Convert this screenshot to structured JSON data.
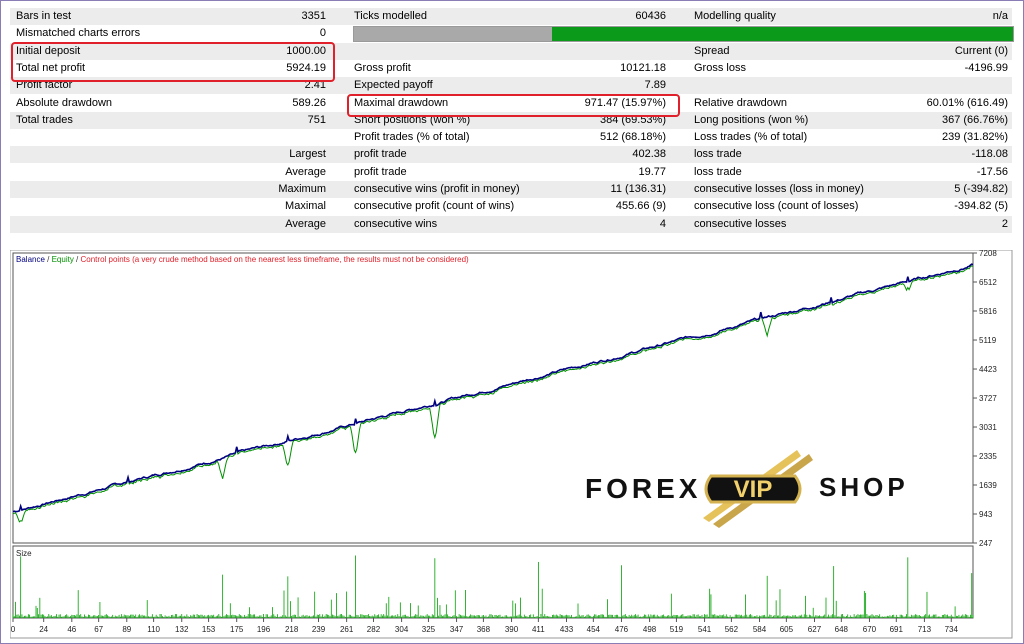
{
  "report": {
    "rows": [
      {
        "c1": "Bars in test",
        "c2": "3351",
        "c3": "Ticks modelled",
        "c4": "60436",
        "c5": "Modelling quality",
        "c6": "n/a"
      },
      {
        "c1": "Mismatched charts errors",
        "c2": "0",
        "c3": "",
        "c4": "",
        "c5": "",
        "c6": ""
      },
      {
        "c1": "Initial deposit",
        "c2": "1000.00",
        "c3": "",
        "c4": "",
        "c5": "Spread",
        "c6": "Current (0)"
      },
      {
        "c1": "Total net profit",
        "c2": "5924.19",
        "c3": "Gross profit",
        "c4": "10121.18",
        "c5": "Gross loss",
        "c6": "-4196.99"
      },
      {
        "c1": "Profit factor",
        "c2": "2.41",
        "c3": "Expected payoff",
        "c4": "7.89",
        "c5": "",
        "c6": ""
      },
      {
        "c1": "Absolute drawdown",
        "c2": "589.26",
        "c3": "Maximal drawdown",
        "c4": "971.47 (15.97%)",
        "c5": "Relative drawdown",
        "c6": "60.01% (616.49)"
      },
      {
        "c1": "Total trades",
        "c2": "751",
        "c3": "Short positions (won %)",
        "c4": "384 (69.53%)",
        "c5": "Long positions (won %)",
        "c6": "367 (66.76%)"
      },
      {
        "c1": "",
        "c2": "",
        "c3": "Profit trades (% of total)",
        "c4": "512 (68.18%)",
        "c5": "Loss trades (% of total)",
        "c6": "239 (31.82%)"
      },
      {
        "c1r": "Largest",
        "c3": "profit trade",
        "c4": "402.38",
        "c5": "loss trade",
        "c6": "-118.08"
      },
      {
        "c1r": "Average",
        "c3": "profit trade",
        "c4": "19.77",
        "c5": "loss trade",
        "c6": "-17.56"
      },
      {
        "c1r": "Maximum",
        "c3": "consecutive wins (profit in money)",
        "c4": "11 (136.31)",
        "c5": "consecutive losses (loss in money)",
        "c6": "5 (-394.82)"
      },
      {
        "c1r": "Maximal",
        "c3": "consecutive profit (count of wins)",
        "c4": "455.66 (9)",
        "c5": "consecutive loss (count of losses)",
        "c6": "-394.82 (5)"
      },
      {
        "c1r": "Average",
        "c3": "consecutive wins",
        "c4": "4",
        "c5": "consecutive losses",
        "c6": "2"
      }
    ],
    "modelling_quality_bar": {
      "gray_fraction": 0.3,
      "colors": {
        "gray": "#a9a9a9",
        "green": "#0c9a1a"
      }
    },
    "highlight_color": "#e0202a"
  },
  "chart_data": {
    "type": "line",
    "legend": {
      "balance": "Balance",
      "equity": "Equity",
      "control": "Control points (a very crude method based on the nearest less timeframe, the results must not be considered)"
    },
    "colors": {
      "balance": "#000080",
      "equity": "#009000",
      "control": "#e0202a",
      "size_bars": "#00a000",
      "legend_balance": "#000080",
      "legend_equity": "#009000"
    },
    "ylim": [
      247,
      7208
    ],
    "y_ticks": [
      "7208",
      "6512",
      "5816",
      "5119",
      "4423",
      "3727",
      "3031",
      "2335",
      "1639",
      "943",
      "247"
    ],
    "x_ticks": [
      "0",
      "24",
      "46",
      "67",
      "89",
      "110",
      "132",
      "153",
      "175",
      "196",
      "218",
      "239",
      "261",
      "282",
      "304",
      "325",
      "347",
      "368",
      "390",
      "411",
      "433",
      "454",
      "476",
      "498",
      "519",
      "541",
      "562",
      "584",
      "605",
      "627",
      "648",
      "670",
      "691",
      "713",
      "734"
    ],
    "xlim": [
      0,
      751
    ],
    "balance": {
      "start": 1000,
      "end": 6924
    },
    "equity_dips": [
      {
        "trade": 6,
        "value": 780
      },
      {
        "trade": 164,
        "value": 1790
      },
      {
        "trade": 215,
        "value": 2120
      },
      {
        "trade": 268,
        "value": 2420
      },
      {
        "trade": 330,
        "value": 2780
      },
      {
        "trade": 590,
        "value": 5220
      },
      {
        "trade": 642,
        "value": 5960
      },
      {
        "trade": 700,
        "value": 6380
      }
    ],
    "size_panel": {
      "label": "Size"
    }
  },
  "watermark": {
    "left": "FOREX",
    "center": "VIP",
    "right": "SHOP"
  }
}
